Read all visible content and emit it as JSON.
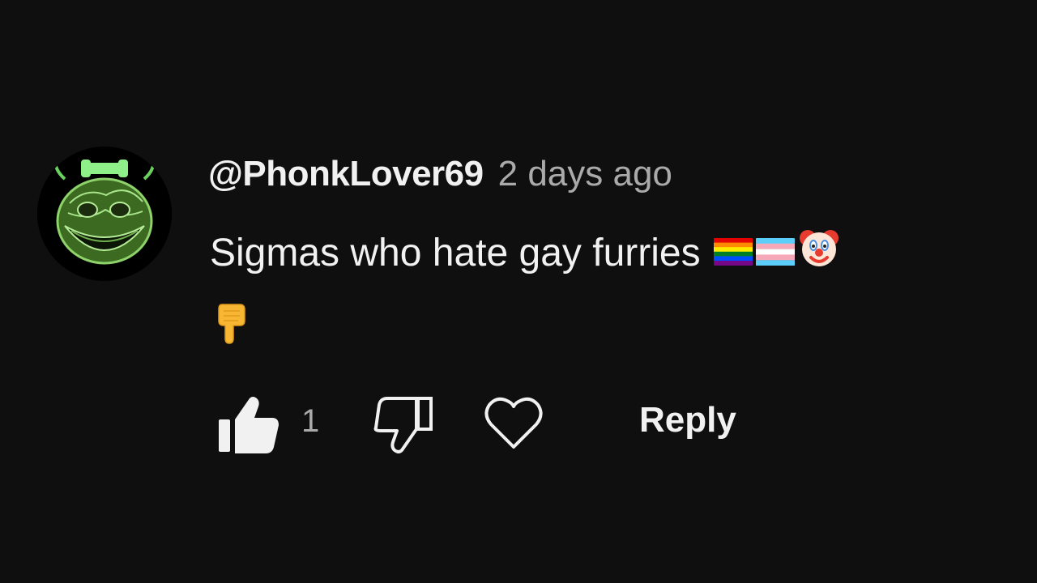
{
  "comment": {
    "username": "@PhonkLover69",
    "timestamp": "2 days ago",
    "text": "Sigmas who hate gay furries",
    "emojis": [
      "rainbow-flag-icon",
      "transgender-flag-icon",
      "clown-face-icon"
    ],
    "second_line_emoji": "pointing-down-icon"
  },
  "actions": {
    "like_count": "1",
    "reply_label": "Reply"
  },
  "colors": {
    "background": "#0f0f0f",
    "primary_text": "#f1f1f1",
    "secondary_text": "#aaaaaa",
    "avatar_green": "#7fd85a"
  }
}
